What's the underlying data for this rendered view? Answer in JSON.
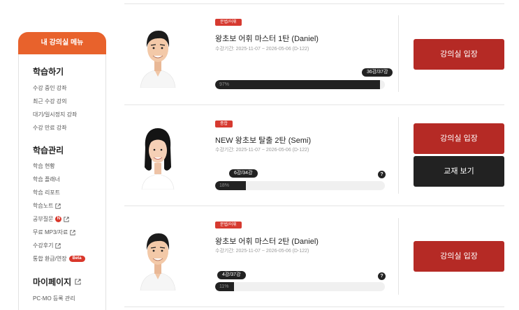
{
  "sidebar": {
    "header": "내 강의실 메뉴",
    "sections": [
      {
        "title": "학습하기",
        "items": [
          "수강 중인 강좌",
          "최근 수강 강의",
          "대기/일시정지 강좌",
          "수강 만료 강좌"
        ]
      },
      {
        "title": "학습관리",
        "items": [
          "학습 현황",
          "학습 플래너",
          "학습 리포트",
          "학습노트",
          "공부질문",
          "무료 MP3/자료",
          "수강후기",
          "통합 환급/연장"
        ]
      },
      {
        "title": "마이페이지",
        "items": [
          "PC·MO 등록 관리"
        ]
      }
    ],
    "badges": {
      "question": "N",
      "beta": "Beta"
    }
  },
  "courses": [
    {
      "category": "문법/어휘",
      "title": "왕초보 어휘 마스터 1탄 (Daniel)",
      "period": "수강기간: 2025-11-07 ~ 2026-05-06 (D-122)",
      "progress_label": "36강/37강",
      "progress_percent": "97%",
      "progress_value": 0.97,
      "instructor_photo": "male-instructor-photo",
      "buttons": [
        "강의실 입장"
      ]
    },
    {
      "category": "종합",
      "title": "NEW 왕초보 탈출 2탄 (Semi)",
      "period": "수강기간: 2025-11-07 ~ 2026-05-06 (D-122)",
      "progress_label": "6강/34강",
      "progress_percent": "18%",
      "progress_value": 0.18,
      "instructor_photo": "female-instructor-photo",
      "buttons": [
        "강의실 입장",
        "교재 보기"
      ]
    },
    {
      "category": "문법/어휘",
      "title": "왕초보 어휘 마스터 2탄 (Daniel)",
      "period": "수강기간: 2025-11-07 ~ 2026-05-06 (D-122)",
      "progress_label": "4강/37강",
      "progress_percent": "11%",
      "progress_value": 0.11,
      "instructor_photo": "male-instructor-photo",
      "buttons": [
        "강의실 입장"
      ]
    }
  ],
  "help_mark": "?",
  "colors": {
    "accent_orange": "#e8622c",
    "button_red": "#b52a25",
    "button_dark": "#222222",
    "badge_red": "#d63a30"
  }
}
